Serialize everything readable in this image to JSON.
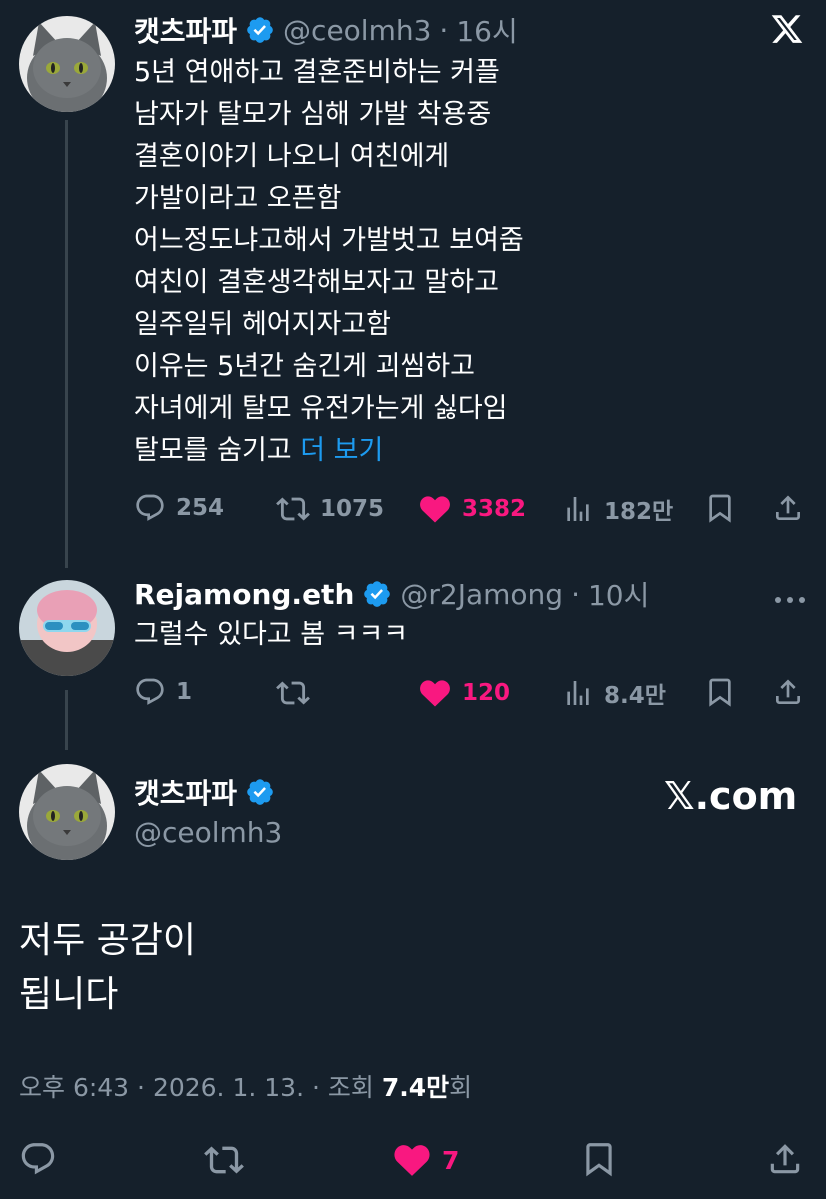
{
  "tweet1": {
    "name": "캣츠파파",
    "handle": "@ceolmh3",
    "time": "16시",
    "lines": [
      "5년 연애하고 결혼준비하는 커플",
      "남자가 탈모가 심해 가발 착용중",
      "결혼이야기 나오니 여친에게",
      "가발이라고 오픈함",
      "어느정도냐고해서 가발벗고 보여줌",
      "여친이 결혼생각해보자고 말하고",
      "일주일뒤 헤어지자고함",
      "이유는 5년간 숨긴게 괴씸하고",
      "자녀에게 탈모 유전가는게 싫다임"
    ],
    "last_line": "탈모를 숨기고",
    "more_label": "더 보기",
    "replies": "254",
    "retweets": "1075",
    "likes": "3382",
    "views": "182만"
  },
  "tweet2": {
    "name": "Rejamong.eth",
    "handle": "@r2Jamong",
    "time": "10시",
    "text": "그럴수 있다고 봄 ㅋㅋㅋ",
    "replies": "1",
    "likes": "120",
    "views": "8.4만"
  },
  "main": {
    "name": "캣츠파파",
    "handle": "@ceolmh3",
    "watermark": "𝕏.com",
    "lines": [
      "저두 공감이",
      "됩니다"
    ],
    "time": "오후 6:43",
    "date": "2026. 1. 13.",
    "views_label": "조회",
    "views_count": "7.4만",
    "views_suffix": "회",
    "likes": "7"
  },
  "colors": {
    "background": "#15202b",
    "muted": "#8b98a5",
    "like": "#f91880",
    "link": "#1d9bf0",
    "verified": "#1d9bf0"
  },
  "icons": [
    "x-logo-icon",
    "verified-icon",
    "reply-icon",
    "retweet-icon",
    "heart-icon",
    "views-icon",
    "bookmark-icon",
    "share-icon",
    "more-icon"
  ]
}
